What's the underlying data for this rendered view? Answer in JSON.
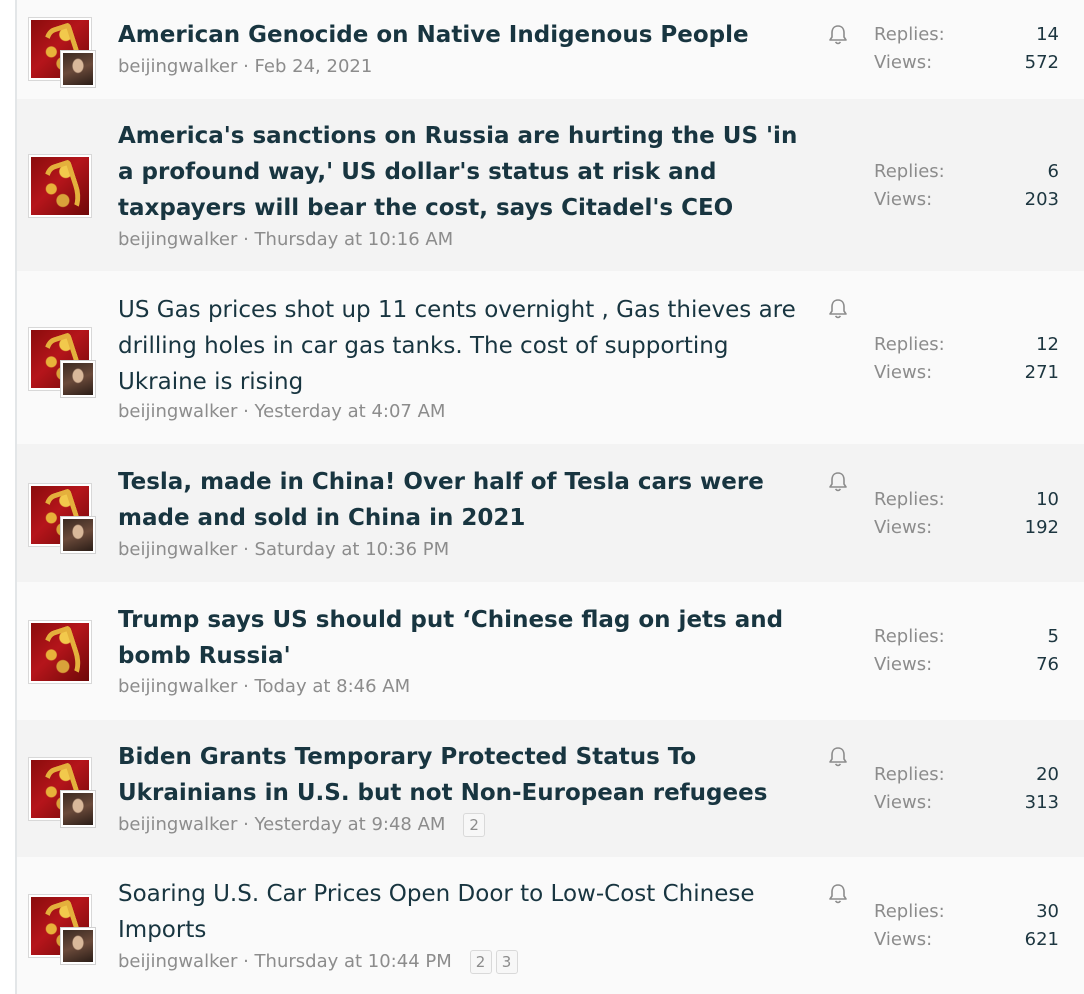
{
  "threads": [
    {
      "title": "American Genocide on Native Indigenous People",
      "author": "beijingwalker",
      "date": "Feb 24, 2021",
      "pages": [],
      "replies_label": "Replies:",
      "replies": "14",
      "views_label": "Views:",
      "views": "572",
      "bold": true,
      "watched": true
    },
    {
      "title": "America's sanctions on Russia are hurting the US 'in a profound way,' US dollar's status at risk and taxpayers will bear the cost, says Citadel's CEO",
      "author": "beijingwalker",
      "date": "Thursday at 10:16 AM",
      "pages": [],
      "replies_label": "Replies:",
      "replies": "6",
      "views_label": "Views:",
      "views": "203",
      "bold": true,
      "watched": false
    },
    {
      "title": "US Gas prices shot up 11 cents overnight , Gas thieves are drilling holes in car gas tanks. The cost of supporting Ukraine is rising",
      "author": "beijingwalker",
      "date": "Yesterday at 4:07 AM",
      "pages": [],
      "replies_label": "Replies:",
      "replies": "12",
      "views_label": "Views:",
      "views": "271",
      "bold": false,
      "watched": true
    },
    {
      "title": "Tesla, made in China! Over half of Tesla cars were made and sold in China in 2021",
      "author": "beijingwalker",
      "date": "Saturday at 10:36 PM",
      "pages": [],
      "replies_label": "Replies:",
      "replies": "10",
      "views_label": "Views:",
      "views": "192",
      "bold": true,
      "watched": true
    },
    {
      "title": "Trump says US should put ‘Chinese flag on jets and bomb Russia'",
      "author": "beijingwalker",
      "date": "Today at 8:46 AM",
      "pages": [],
      "replies_label": "Replies:",
      "replies": "5",
      "views_label": "Views:",
      "views": "76",
      "bold": true,
      "watched": false
    },
    {
      "title": "Biden Grants Temporary Protected Status To Ukrainians in U.S. but not Non-European refugees",
      "author": "beijingwalker",
      "date": "Yesterday at 9:48 AM",
      "pages": [
        "2"
      ],
      "replies_label": "Replies:",
      "replies": "20",
      "views_label": "Views:",
      "views": "313",
      "bold": true,
      "watched": true
    },
    {
      "title": "Soaring U.S. Car Prices Open Door to Low-Cost Chinese Imports",
      "author": "beijingwalker",
      "date": "Thursday at 10:44 PM",
      "pages": [
        "2",
        "3"
      ],
      "replies_label": "Replies:",
      "replies": "30",
      "views_label": "Views:",
      "views": "621",
      "bold": false,
      "watched": true
    }
  ]
}
